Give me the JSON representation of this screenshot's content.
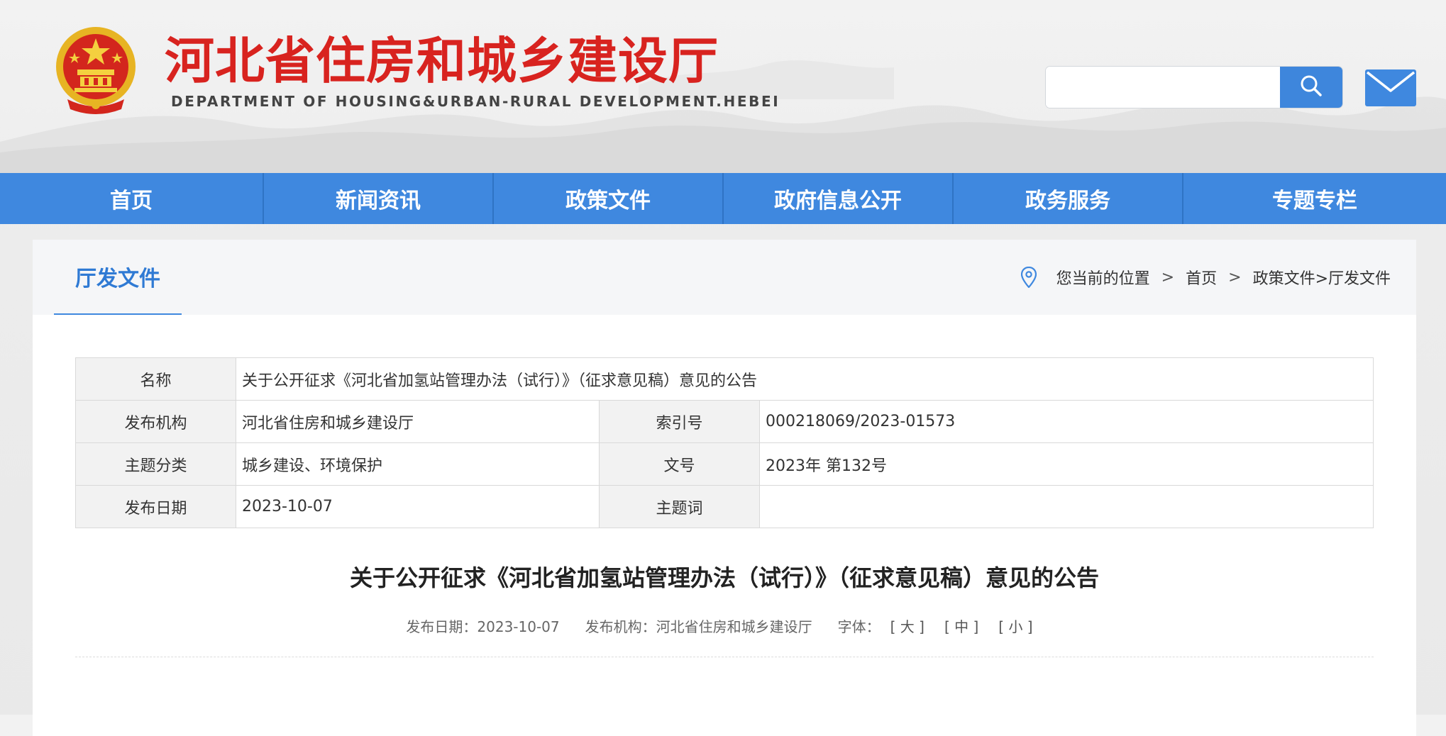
{
  "header": {
    "title": "河北省住房和城乡建设厅",
    "subtitle": "DEPARTMENT OF HOUSING&URBAN-RURAL DEVELOPMENT.HEBEI",
    "search": {
      "value": "",
      "placeholder": ""
    },
    "icons": {
      "emblem": "national-emblem",
      "search": "search-icon",
      "mail": "mail-icon"
    },
    "colors": {
      "title_red": "#d8231f",
      "accent_blue": "#3f88df"
    }
  },
  "nav": {
    "items": [
      {
        "label": "首页"
      },
      {
        "label": "新闻资讯"
      },
      {
        "label": "政策文件"
      },
      {
        "label": "政府信息公开"
      },
      {
        "label": "政务服务"
      },
      {
        "label": "专题专栏"
      }
    ]
  },
  "section": {
    "title": "厅发文件"
  },
  "breadcrumb": {
    "prefix": "您当前的位置",
    "sep1": ">",
    "home": "首页",
    "sep2": ">",
    "path": "政策文件>厅发文件"
  },
  "info": {
    "name_label": "名称",
    "name_value": "关于公开征求《河北省加氢站管理办法（试行）》（征求意见稿）意见的公告",
    "publisher_label": "发布机构",
    "publisher_value": "河北省住房和城乡建设厅",
    "index_label": "索引号",
    "index_value": "000218069/2023-01573",
    "topic_label": "主题分类",
    "topic_value": "城乡建设、环境保护",
    "docno_label": "文号",
    "docno_value": "2023年 第132号",
    "date_label": "发布日期",
    "date_value": "2023-10-07",
    "keywords_label": "主题词",
    "keywords_value": ""
  },
  "article": {
    "title": "关于公开征求《河北省加氢站管理办法（试行）》（征求意见稿）意见的公告",
    "meta_date": "发布日期：2023-10-07",
    "meta_publisher": "发布机构：河北省住房和城乡建设厅",
    "font_label": "字体：",
    "font_large": "[ 大 ]",
    "font_medium": "[ 中 ]",
    "font_small": "[ 小 ]"
  }
}
